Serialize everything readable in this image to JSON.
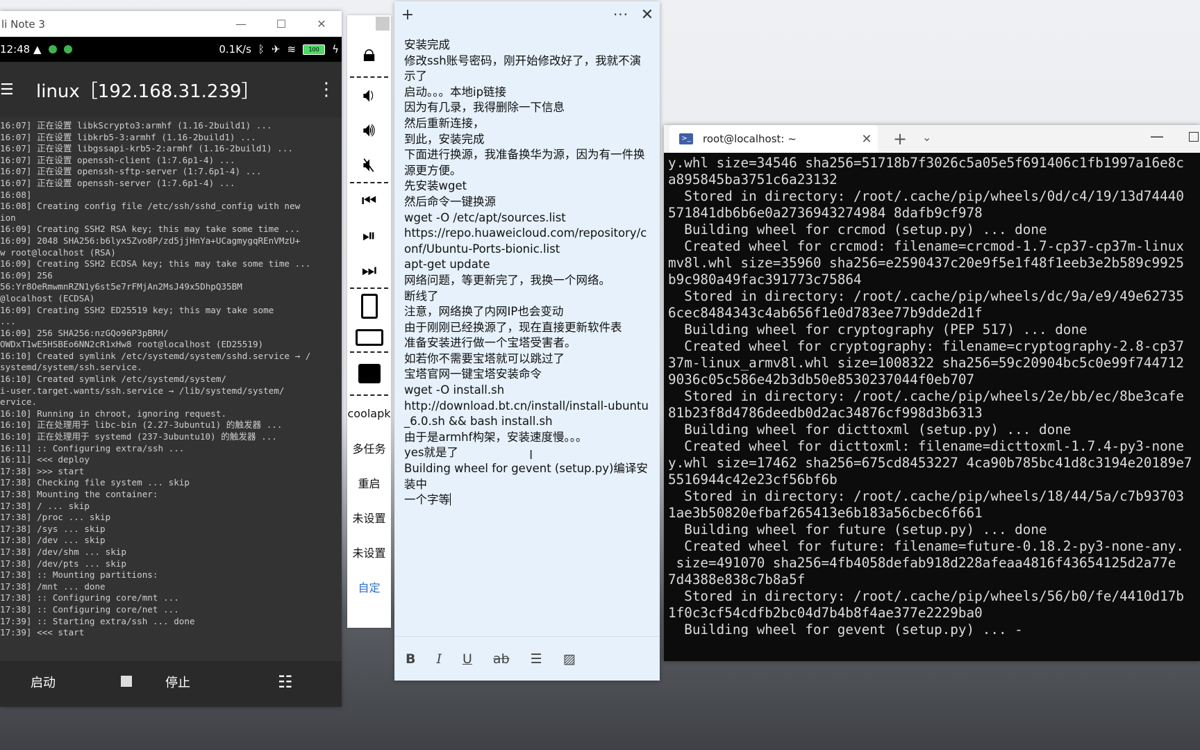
{
  "phone_window": {
    "title": "li Note 3",
    "controls": {
      "minimize": "—",
      "maximize": "☐",
      "close": "✕"
    },
    "status_bar": {
      "time": "12:48",
      "net_speed": "0.1K/s",
      "battery": "100"
    },
    "header": {
      "title": "linux［192.168.31.239］"
    },
    "log_lines": [
      "16:07] 正在设置 libkScrypto3:armhf (1.16-2build1) ...",
      "16:07] 正在设置 libkrb5-3:armhf (1.16-2build1) ...",
      "16:07] 正在设置 libgssapi-krb5-2:armhf (1.16-2build1) ...",
      "16:07] 正在设置 openssh-client (1:7.6p1-4) ...",
      "16:07] 正在设置 openssh-sftp-server (1:7.6p1-4) ...",
      "16:07] 正在设置 openssh-server (1:7.6p1-4) ...",
      "16:08]",
      "16:08] Creating config file /etc/ssh/sshd_config with new",
      "ion",
      "16:09] Creating SSH2 RSA key; this may take some time ...",
      "16:09] 2048 SHA256:b6lyx5Zvo8P/zd5jjHnYa+UCagmygqREnVMzU+",
      "w root@localhost (RSA)",
      "16:09] Creating SSH2 ECDSA key; this may take some time ...",
      "16:09] 256",
      "56:Yr8OeRmwmnRZN1y6st5e7rFMjAn2MsJ49x5DhpQ35BM",
      "@localhost (ECDSA)",
      "16:09] Creating SSH2 ED25519 key; this may take some",
      "...",
      "16:09] 256 SHA256:nzGQo96P3pBRH/",
      "OWDxT1wE5HSBEo6NN2cR1xHw8 root@localhost (ED25519)",
      "16:10] Created symlink /etc/systemd/system/sshd.service → /",
      "systemd/system/ssh.service.",
      "16:10] Created symlink /etc/systemd/system/",
      "i-user.target.wants/ssh.service → /lib/systemd/system/",
      "ervice.",
      "16:10] Running in chroot, ignoring request.",
      "16:10] 正在处理用于 libc-bin (2.27-3ubuntu1) 的触发器 ...",
      "16:10] 正在处理用于 systemd (237-3ubuntu10) 的触发器 ...",
      "16:11] :: Configuring extra/ssh ...",
      "16:11] <<< deploy",
      "17:38] >>> start",
      "17:38] Checking file system ... skip",
      "17:38] Mounting the container:",
      "17:38] / ... skip",
      "17:38] /proc ... skip",
      "17:38] /sys ... skip",
      "17:38] /dev ... skip",
      "17:38] /dev/shm ... skip",
      "17:38] /dev/pts ... skip",
      "17:38] :: Mounting partitions:",
      "17:38] /mnt ... done",
      "17:38] :: Configuring core/mnt ...",
      "17:38] :: Configuring core/net ...",
      "17:39] :: Starting extra/ssh ... done",
      "17:39] <<< start"
    ],
    "bottom_bar": {
      "start_label": "启动",
      "stop_label": "停止"
    }
  },
  "side_toolbar": {
    "text_buttons": [
      "coolapk",
      "多任务",
      "重启",
      "未设置",
      "未设置",
      "自定"
    ]
  },
  "note": {
    "lines": [
      "安装完成",
      "修改ssh账号密码，刚开始修改好了，我就不演示了",
      "启动。。。本地ip链接",
      "因为有几录，我得删除一下信息",
      "然后重新连接，",
      "到此，安装完成",
      "下面进行换源，我准备换华为源，因为有一件换源更方便。",
      "先安装wget",
      "然后命令一键换源",
      "wget -O /etc/apt/sources.list",
      "https://repo.huaweicloud.com/repository/conf/Ubuntu-Ports-bionic.list",
      "apt-get update",
      "网络问题，等更新完了，我换一个网络。",
      "断线了",
      "注意，网络换了内网IP也会变动",
      "由于刚刚已经换源了，现在直接更新软件表",
      "准备安装进行做一个宝塔受害者。",
      "如若你不需要宝塔就可以跳过了",
      "宝塔官网一键宝塔安装命令",
      "wget -O install.sh",
      "http://download.bt.cn/install/install-ubuntu_6.0.sh && bash install.sh",
      "由于是armhf构架，安装速度慢。。。",
      "yes就是了",
      " Building wheel for gevent (setup.py)编译安装中",
      "一个字等"
    ],
    "toolbar": {
      "bold": "B",
      "italic": "I",
      "underline": "U",
      "strike": "ab"
    }
  },
  "terminal": {
    "tab_title": "root@localhost: ~",
    "lines": [
      "y.whl size=34546 sha256=51718b7f3026c5a05e5f691406c1fb1997a16e8c",
      "a895845ba3751c6a23132",
      "  Stored in directory: /root/.cache/pip/wheels/0d/c4/19/13d74440",
      "571841db6b6e0a2736943274984 8dafb9cf978",
      "  Building wheel for crcmod (setup.py) ... done",
      "  Created wheel for crcmod: filename=crcmod-1.7-cp37-cp37m-linux",
      "mv8l.whl size=35960 sha256=e2590437c20e9f5e1f48f1eeb3e2b589c9925",
      "b9c980a49fac391773c75864",
      "  Stored in directory: /root/.cache/pip/wheels/dc/9a/e9/49e62735",
      "6cec8484343c4ab656f1e0d783ee77b9dde2d1f",
      "  Building wheel for cryptography (PEP 517) ... done",
      "  Created wheel for cryptography: filename=cryptography-2.8-cp37",
      "37m-linux_armv8l.whl size=1008322 sha256=59c20904bc5c0e99f744712",
      "9036c05c586e42b3db50e8530237044f0eb707",
      "  Stored in directory: /root/.cache/pip/wheels/2e/bb/ec/8be3cafe",
      "81b23f8d4786deedb0d2ac34876cf998d3b6313",
      "  Building wheel for dicttoxml (setup.py) ... done",
      "  Created wheel for dicttoxml: filename=dicttoxml-1.7.4-py3-none",
      "y.whl size=17462 sha256=675cd8453227 4ca90b785bc41d8c3194e20189e7",
      "5516944c42e23cf56bf6b",
      "  Stored in directory: /root/.cache/pip/wheels/18/44/5a/c7b93703",
      "1ae3b50820efbaf265413e6b183a56cbec6f661",
      "  Building wheel for future (setup.py) ... done",
      "  Created wheel for future: filename=future-0.18.2-py3-none-any.",
      " size=491070 sha256=4fb4058defab918d228afeaa4816f43654125d2a77e",
      "7d4388e838c7b8a5f",
      "  Stored in directory: /root/.cache/pip/wheels/56/b0/fe/4410d17b",
      "1f0c3cf54cdfb2bc04d7b4b8f4ae377e2229ba0",
      "  Building wheel for gevent (setup.py) ... -"
    ]
  }
}
